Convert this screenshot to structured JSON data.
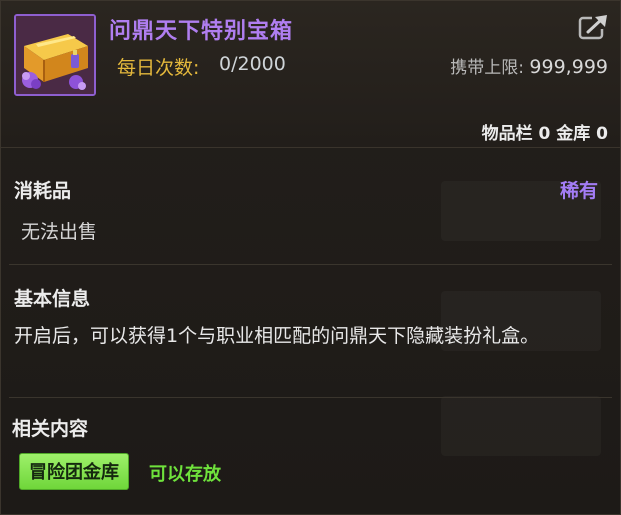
{
  "item": {
    "name": "问鼎天下特别宝箱",
    "icon": "treasure-chest-icon",
    "name_color": "#b07ef0"
  },
  "usage": {
    "daily_label": "每日次数:",
    "daily_value": "0/2000",
    "carry_label": "携带上限:",
    "carry_value": "999,999"
  },
  "storage": {
    "text": "物品栏 0 金库 0"
  },
  "category": {
    "title": "消耗品",
    "rarity": "稀有",
    "rarity_color": "#a37df5",
    "sell_status": "无法出售"
  },
  "basic_info": {
    "title": "基本信息",
    "description": "开启后，可以获得1个与职业相匹配的问鼎天下隐藏装扮礼盒。"
  },
  "related": {
    "title": "相关内容",
    "button_label": "冒险团金库",
    "button_color": "#7ee04a",
    "status": "可以存放",
    "status_color": "#6fe23c"
  },
  "icons": {
    "share": "share-export-icon"
  }
}
